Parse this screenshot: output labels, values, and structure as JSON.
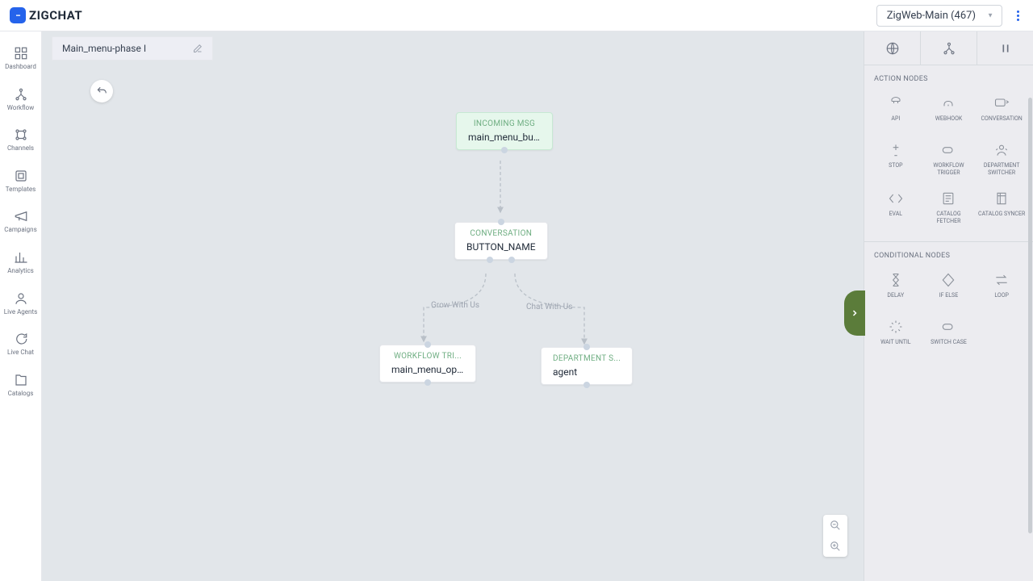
{
  "header": {
    "logo_text": "ZIGCHAT",
    "project": "ZigWeb-Main (467)"
  },
  "sidebar": {
    "items": [
      {
        "label": "Dashboard",
        "icon": "dashboard"
      },
      {
        "label": "Workflow",
        "icon": "workflow"
      },
      {
        "label": "Channels",
        "icon": "channels"
      },
      {
        "label": "Templates",
        "icon": "templates"
      },
      {
        "label": "Campaigns",
        "icon": "campaigns"
      },
      {
        "label": "Analytics",
        "icon": "analytics"
      },
      {
        "label": "Live Agents",
        "icon": "agents"
      },
      {
        "label": "Live Chat",
        "icon": "chat"
      },
      {
        "label": "Catalogs",
        "icon": "catalogs"
      }
    ]
  },
  "workflow": {
    "name": "Main_menu-phase I",
    "nodes": [
      {
        "id": "n1",
        "type": "INCOMING MSG",
        "title": "main_menu_bu..."
      },
      {
        "id": "n2",
        "type": "CONVERSATION",
        "title": "BUTTON_NAME"
      },
      {
        "id": "n3",
        "type": "WORKFLOW TRI...",
        "title": "main_menu_op..."
      },
      {
        "id": "n4",
        "type": "DEPARTMENT S...",
        "title": "agent"
      }
    ],
    "edges": [
      {
        "label": "Grow With Us"
      },
      {
        "label": "Chat With Us"
      }
    ]
  },
  "panel": {
    "sections": [
      {
        "title": "ACTION NODES",
        "items": [
          {
            "label": "API"
          },
          {
            "label": "WEBHOOK"
          },
          {
            "label": "CONVERSATION"
          },
          {
            "label": "STOP"
          },
          {
            "label": "WORKFLOW TRIGGER"
          },
          {
            "label": "DEPARTMENT SWITCHER"
          },
          {
            "label": "EVAL"
          },
          {
            "label": "CATALOG FETCHER"
          },
          {
            "label": "CATALOG SYNCER"
          }
        ]
      },
      {
        "title": "CONDITIONAL NODES",
        "items": [
          {
            "label": "DELAY"
          },
          {
            "label": "IF ELSE"
          },
          {
            "label": "LOOP"
          },
          {
            "label": "WAIT UNTIL"
          },
          {
            "label": "SWITCH CASE"
          }
        ]
      }
    ]
  }
}
